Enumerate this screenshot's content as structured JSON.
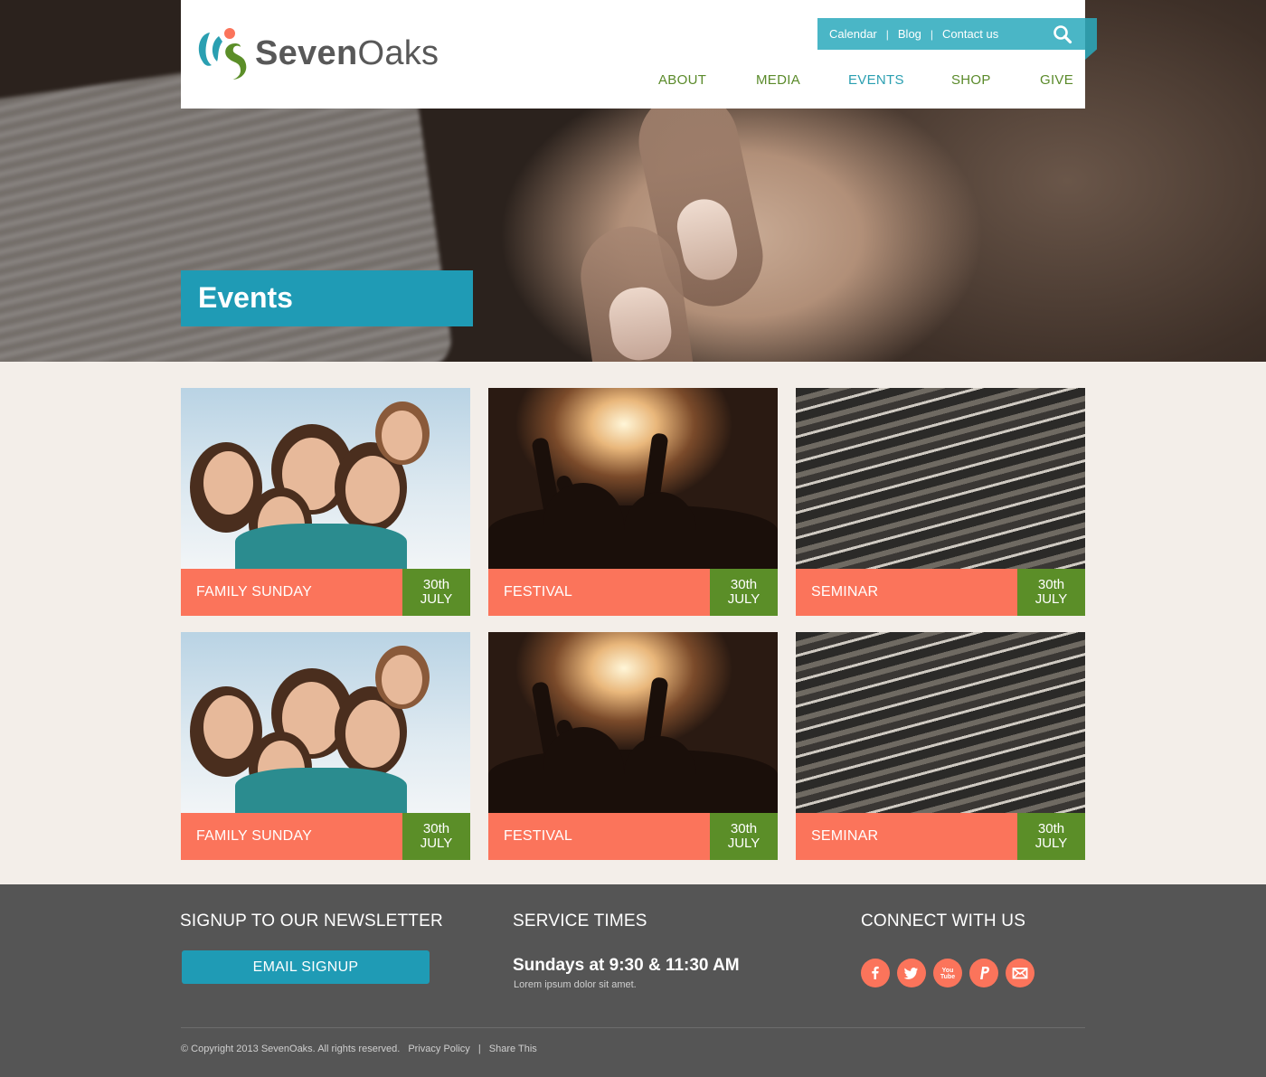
{
  "brand": {
    "name_bold": "Seven",
    "name_light": "Oaks"
  },
  "topbar": {
    "links": [
      "Calendar",
      "Blog",
      "Contact us"
    ],
    "search_icon": "search-icon"
  },
  "nav": {
    "items": [
      "ABOUT",
      "MEDIA",
      "EVENTS",
      "SHOP",
      "GIVE"
    ],
    "active": "EVENTS"
  },
  "hero": {
    "title": "Events"
  },
  "events": [
    {
      "title": "FAMILY SUNDAY",
      "day": "30th",
      "month": "JULY",
      "image": "family-photo"
    },
    {
      "title": "FESTIVAL",
      "day": "30th",
      "month": "JULY",
      "image": "concert-photo"
    },
    {
      "title": "SEMINAR",
      "day": "30th",
      "month": "JULY",
      "image": "auditorium-photo"
    },
    {
      "title": "FAMILY SUNDAY",
      "day": "30th",
      "month": "JULY",
      "image": "family-photo"
    },
    {
      "title": "FESTIVAL",
      "day": "30th",
      "month": "JULY",
      "image": "concert-photo"
    },
    {
      "title": "SEMINAR",
      "day": "30th",
      "month": "JULY",
      "image": "auditorium-photo"
    }
  ],
  "footer": {
    "newsletter_heading": "SIGNUP TO OUR NEWSLETTER",
    "signup_button": "EMAIL SIGNUP",
    "service_heading": "SERVICE TIMES",
    "service_time": "Sundays at 9:30 & 11:30 AM",
    "service_sub": "Lorem ipsum dolor sit amet.",
    "connect_heading": "CONNECT WITH US",
    "social_icons": [
      "facebook-icon",
      "twitter-icon",
      "youtube-icon",
      "paypal-icon",
      "email-icon"
    ],
    "copyright": "© Copyright 2013 SevenOaks. All rights reserved.",
    "privacy": "Privacy Policy",
    "share": "Share This"
  },
  "colors": {
    "teal": "#1f9bb5",
    "topbar_teal": "#4ab6c6",
    "coral": "#fb745b",
    "green": "#5b8e28",
    "nav_green": "#5a8a2a",
    "footer_bg": "#555555",
    "content_bg": "#f3eee9"
  }
}
